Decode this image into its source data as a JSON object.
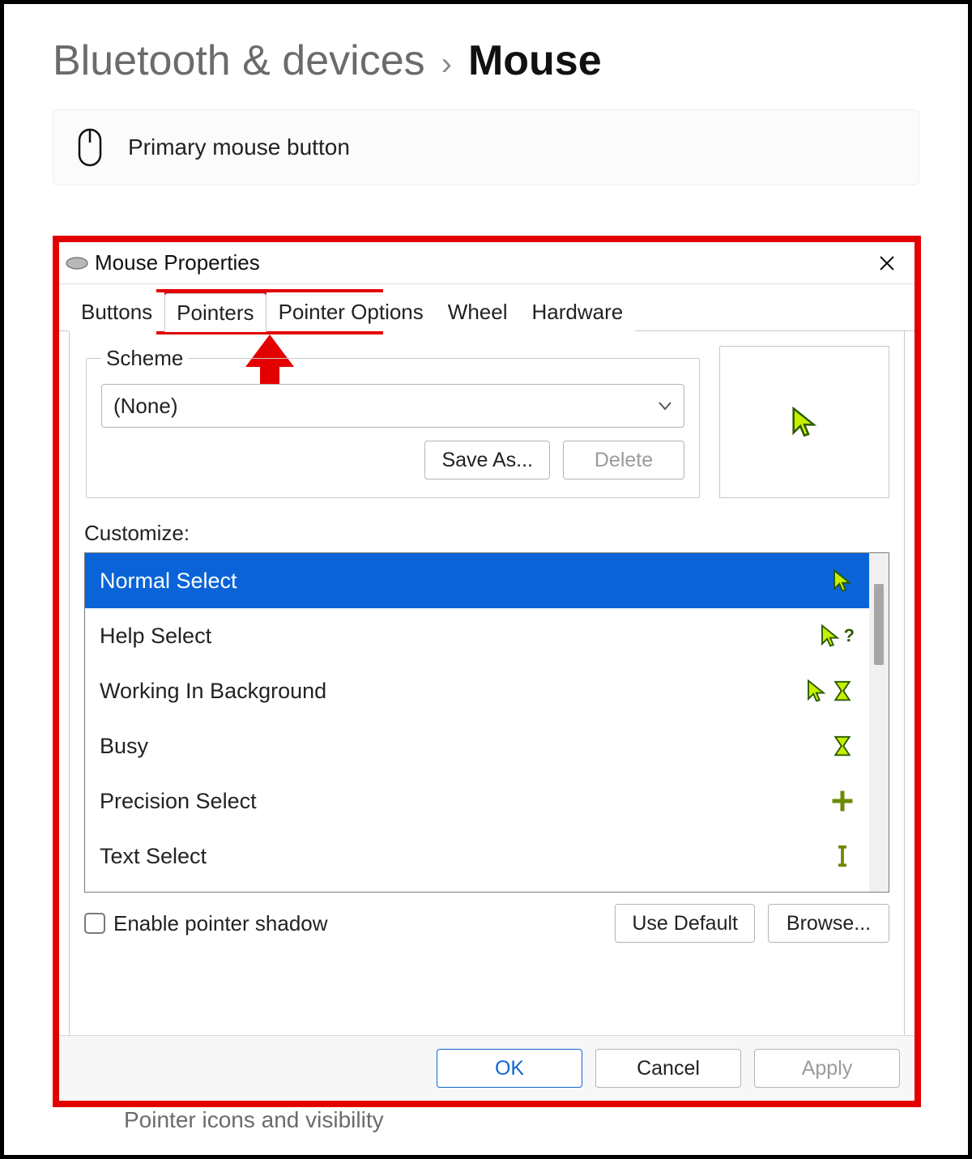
{
  "breadcrumb": {
    "parent": "Bluetooth & devices",
    "current": "Mouse"
  },
  "settings": {
    "primary_label": "Primary mouse button",
    "visibility_label": "Pointer icons and visibility"
  },
  "dialog": {
    "title": "Mouse Properties",
    "tabs": [
      "Buttons",
      "Pointers",
      "Pointer Options",
      "Wheel",
      "Hardware"
    ],
    "active_tab_index": 1,
    "scheme": {
      "legend": "Scheme",
      "selected": "(None)",
      "save_label": "Save As...",
      "delete_label": "Delete"
    },
    "customize_label": "Customize:",
    "list": [
      {
        "label": "Normal Select",
        "icon": "arrow"
      },
      {
        "label": "Help Select",
        "icon": "arrow-question"
      },
      {
        "label": "Working In Background",
        "icon": "arrow-hourglass"
      },
      {
        "label": "Busy",
        "icon": "hourglass"
      },
      {
        "label": "Precision Select",
        "icon": "cross"
      },
      {
        "label": "Text Select",
        "icon": "ibeam"
      }
    ],
    "selected_list_index": 0,
    "shadow_checkbox": "Enable pointer shadow",
    "use_default": "Use Default",
    "browse": "Browse...",
    "ok": "OK",
    "cancel": "Cancel",
    "apply": "Apply"
  }
}
